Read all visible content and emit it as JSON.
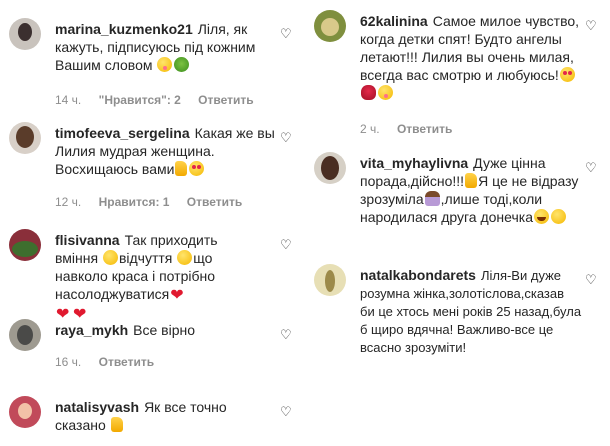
{
  "left": [
    {
      "username": "marina_kuzmenko21",
      "text": "Ліля, як кажуть, підписуюсь під кожним Вашим словом",
      "emojis": [
        "smiling-face-icon",
        "tree-face-icon"
      ],
      "time": "14 ч.",
      "likes": "\"Нравится\": 2",
      "reply": "Ответить",
      "avatar_colors": [
        "#c9c3bd",
        "#3b2f2f"
      ]
    },
    {
      "username": "timofeeva_sergelina",
      "text": "Какая же вы Лилия мудрая женщина. Восхищаюсь вами",
      "emojis": [
        "thumbs-up-icon",
        "heart-eyes-icon"
      ],
      "time": "12 ч.",
      "likes": "Нравится: 1",
      "reply": "Ответить",
      "avatar_colors": [
        "#d8d0c8",
        "#5a3c2a"
      ]
    },
    {
      "username": "flisivanna",
      "text_a": "Так приходить вміння",
      "text_b": "відчуття",
      "text_c": "що навколо краса і потрібно насолоджуватися",
      "emojis": [
        "smiling-face-icon",
        "smiling-face-icon",
        "red-heart-icon",
        "red-heart-icon",
        "red-heart-icon"
      ],
      "avatar_colors": [
        "#8a2f3a",
        "#3e6e2e"
      ]
    },
    {
      "username": "raya_mykh",
      "text": "Все вірно",
      "time": "16 ч.",
      "reply": "Ответить",
      "avatar_colors": [
        "#9e9a90",
        "#4a4a48"
      ]
    },
    {
      "username": "natalisyvash",
      "text": "Як все точно сказано",
      "emojis": [
        "thumbs-up-icon"
      ],
      "avatar_colors": [
        "#c14a5a",
        "#f2c2a8"
      ]
    }
  ],
  "right": [
    {
      "username": "62kalinina",
      "text": "Самое милое чувство, когда детки спят! Будто ангелы летают!!! Лилия вы очень милая, всегда вас смотрю и любуюсь!",
      "emojis": [
        "heart-eyes-icon",
        "rose-icon",
        "yum-face-icon"
      ],
      "time": "2 ч.",
      "reply": "Ответить",
      "avatar_colors": [
        "#7f8f3e",
        "#d9c98a"
      ]
    },
    {
      "username": "vita_myhaylivna",
      "text_a": "Дуже цінна порада,дійсно!!!",
      "text_b": "Я це не відразу зрозуміла",
      "text_c": ",лише тоді,коли народилася друга донечка",
      "emojis": [
        "thumbs-up-icon",
        "woman-facepalming-icon",
        "laughing-face-icon",
        "smiling-face-icon"
      ],
      "avatar_colors": [
        "#d6d0c6",
        "#4a2e22"
      ]
    },
    {
      "username": "natalkabondarets",
      "text": "Ліля-Ви дуже розумна жінка,золотіслова,сказав би це хтось мені років 25 назад,була б щиро вдячна! Важливо-все це всасно зрозуміти!",
      "avatar_colors": [
        "#e7dfb5",
        "#9c8a4a"
      ]
    }
  ]
}
